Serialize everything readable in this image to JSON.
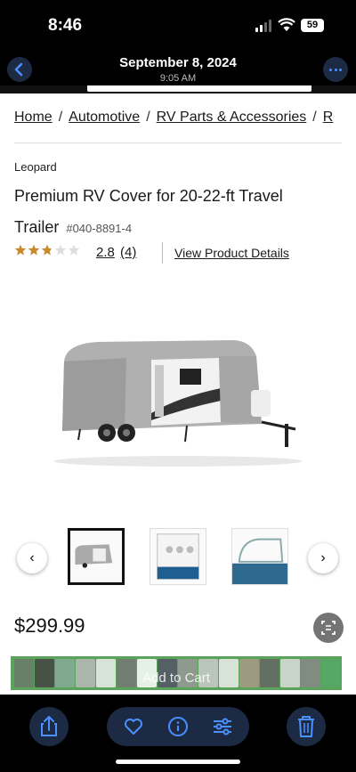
{
  "status": {
    "time": "8:46",
    "battery": "59"
  },
  "header": {
    "date": "September 8, 2024",
    "time": "9:05 AM"
  },
  "breadcrumb": [
    "Home",
    "Automotive",
    "RV Parts & Accessories",
    "R"
  ],
  "product": {
    "brand": "Leopard",
    "title": "Premium RV Cover for 20-22-ft Travel Trailer",
    "sku": "#040-8891-4",
    "rating": "2.8",
    "review_count": "(4)",
    "view_details": "View Product Details",
    "price": "$299.99",
    "add_to_cart": "Add to Cart",
    "stars_filled_fraction": 0.56
  },
  "gallery": {
    "selected_index": 0,
    "prev_icon": "chevron-left-icon",
    "next_icon": "chevron-right-icon"
  },
  "toolbar": {
    "icons": [
      "share-icon",
      "heart-icon",
      "info-icon",
      "adjust-icon",
      "trash-icon"
    ]
  },
  "colors": {
    "accent": "#4a90ff",
    "star": "#c9892d",
    "cart_green": "#5aa35a",
    "button_bg": "#1c2a44"
  }
}
